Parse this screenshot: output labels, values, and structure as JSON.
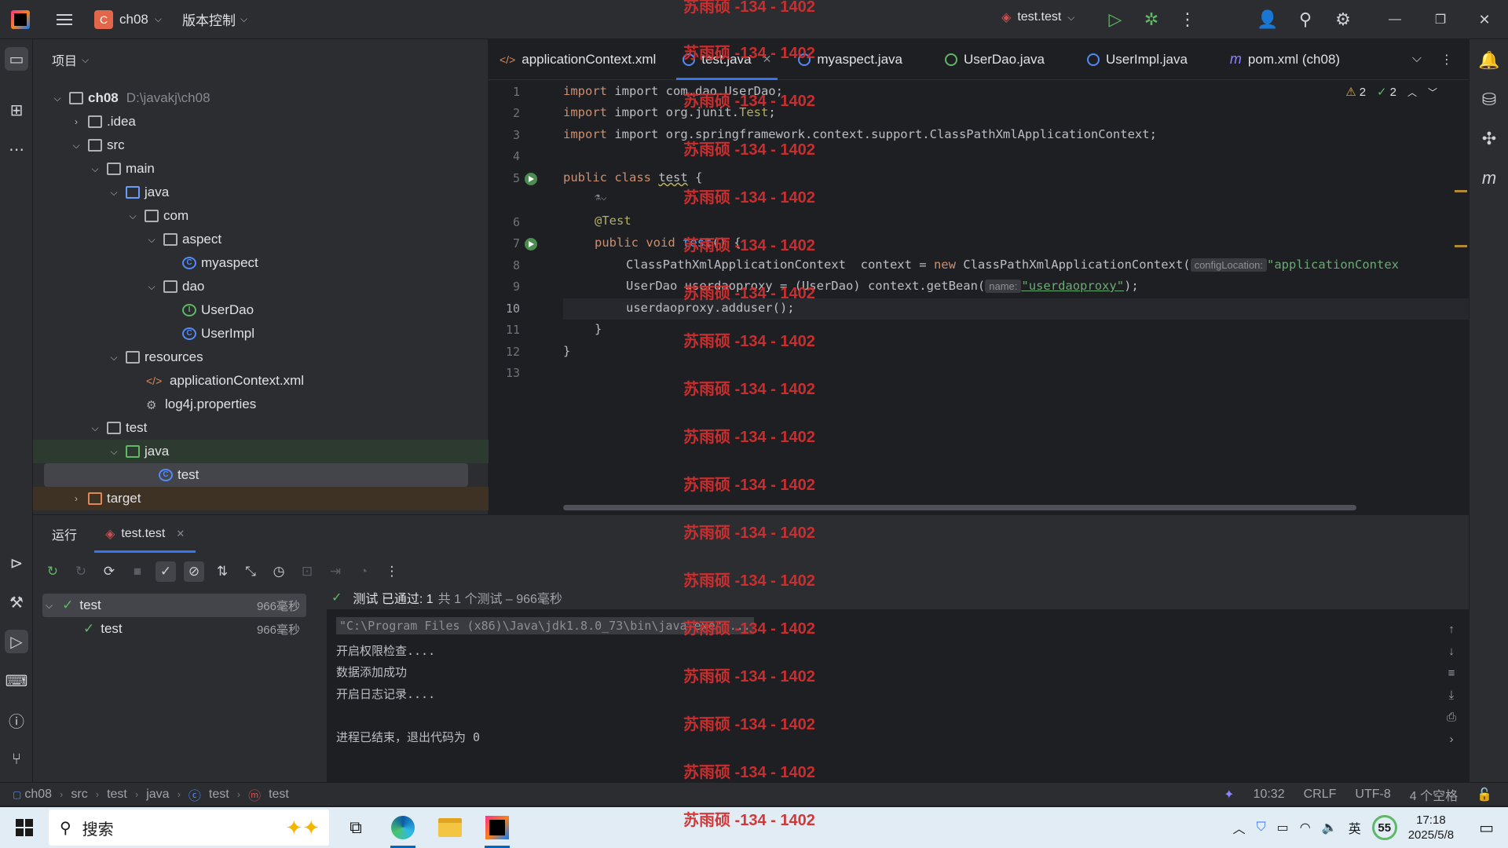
{
  "titlebar": {
    "project_badge": "C",
    "project_name": "ch08",
    "vcs_label": "版本控制",
    "run_config": "test.test"
  },
  "project_panel": {
    "header": "项目",
    "root": {
      "name": "ch08",
      "path": "D:\\javakj\\ch08"
    },
    "tree": [
      {
        "name": ".idea"
      },
      {
        "name": "src"
      },
      {
        "name": "main"
      },
      {
        "name": "java"
      },
      {
        "name": "com"
      },
      {
        "name": "aspect"
      },
      {
        "name": "myaspect"
      },
      {
        "name": "dao"
      },
      {
        "name": "UserDao"
      },
      {
        "name": "UserImpl"
      },
      {
        "name": "resources"
      },
      {
        "name": "applicationContext.xml"
      },
      {
        "name": "log4j.properties"
      },
      {
        "name": "test"
      },
      {
        "name": "java"
      },
      {
        "name": "test"
      },
      {
        "name": "target"
      }
    ]
  },
  "editor": {
    "tabs": [
      {
        "label": "applicationContext.xml"
      },
      {
        "label": "test.java"
      },
      {
        "label": "myaspect.java"
      },
      {
        "label": "UserDao.java"
      },
      {
        "label": "UserImpl.java"
      },
      {
        "label": "pom.xml (ch08)"
      }
    ],
    "warnings": "2",
    "passed": "2",
    "line_numbers": [
      "1",
      "2",
      "3",
      "4",
      "5",
      "6",
      "7",
      "8",
      "9",
      "10",
      "11",
      "12",
      "13"
    ],
    "code": {
      "l1": "import com.dao.UserDao;",
      "l2a": "import org.junit.",
      "l2b": "Test",
      "l2c": ";",
      "l3": "import org.springframework.context.support.ClassPathXmlApplicationContext;",
      "l5a": "public class ",
      "l5b": "test",
      "l5c": " {",
      "l6": "@Test",
      "l7a": "public void ",
      "l7b": "test",
      "l7c": "() {",
      "l8a": "ClassPathXmlApplicationContext  context = ",
      "l8b": "new",
      "l8c": " ClassPathXmlApplicationContext(",
      "l8hint": "configLocation:",
      "l8str": "\"applicationContex",
      "l9a": "UserDao userdaoproxy = (UserDao) context.getBean(",
      "l9hint": "name:",
      "l9str": "\"userdaoproxy\"",
      "l9c": ");",
      "l10": "userdaoproxy.adduser();",
      "l11": "}",
      "l12": "}"
    }
  },
  "run_panel": {
    "title": "运行",
    "tab": "test.test",
    "tests": [
      {
        "name": "test",
        "time": "966毫秒"
      },
      {
        "name": "test",
        "time": "966毫秒"
      }
    ],
    "status_pass": "测试 已通过: 1",
    "status_detail": "共 1 个测试 – 966毫秒",
    "console": {
      "cmd": "\"C:\\Program Files (x86)\\Java\\jdk1.8.0_73\\bin\\java.exe\" ...",
      "line1": "开启权限检查....",
      "line2": "数据添加成功",
      "line3": "开启日志记录....",
      "line4": "进程已结束，退出代码为 0"
    }
  },
  "statusbar": {
    "breadcrumb": [
      "ch08",
      "src",
      "test",
      "java",
      "test",
      "test"
    ],
    "position": "10:32",
    "line_sep": "CRLF",
    "encoding": "UTF-8",
    "indent": "4 个空格"
  },
  "taskbar": {
    "search": "搜索",
    "lang": "英",
    "temp": "55",
    "time": "17:18",
    "date": "2025/5/8"
  },
  "watermark": "苏雨硕 -134 - 1402",
  "colors": {
    "accent": "#3574f0",
    "pass": "#5fb865",
    "watermark": "#d32f2f"
  }
}
